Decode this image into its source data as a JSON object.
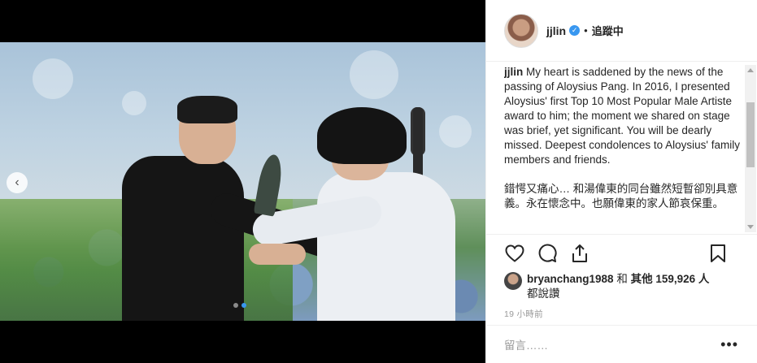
{
  "post": {
    "username": "jjlin",
    "separator": "•",
    "follow_label": "追蹤中",
    "caption_user": "jjlin",
    "caption_en": "My heart is saddened by the news of the passing of Aloysius Pang. In 2016, I presented Aloysius' first Top 10 Most Popular Male Artiste award to him; the moment we shared on stage was brief, yet significant. You will be dearly missed. Deepest condolences to Aloysius' family members and friends.",
    "caption_zh": "錯愕又痛心… 和湯偉東的同台雖然短暫卻別具意義。永在懷念中。也願偉東的家人節哀保重。",
    "likes_user": "bryanchang1988",
    "likes_joiner": " 和 ",
    "likes_others": "其他 159,926 人",
    "likes_suffix": "都說讚",
    "timestamp": "19 小時前",
    "comment_placeholder": "留言……",
    "more_label": "•••"
  },
  "carousel": {
    "total": 2,
    "active": 2
  },
  "icons": [
    "chevron-left-icon",
    "heart-icon",
    "comment-icon",
    "share-icon",
    "bookmark-icon",
    "verified-icon"
  ],
  "colors": {
    "accent": "#3897f0",
    "text": "#262626",
    "muted": "#999999",
    "border": "#efefef"
  }
}
